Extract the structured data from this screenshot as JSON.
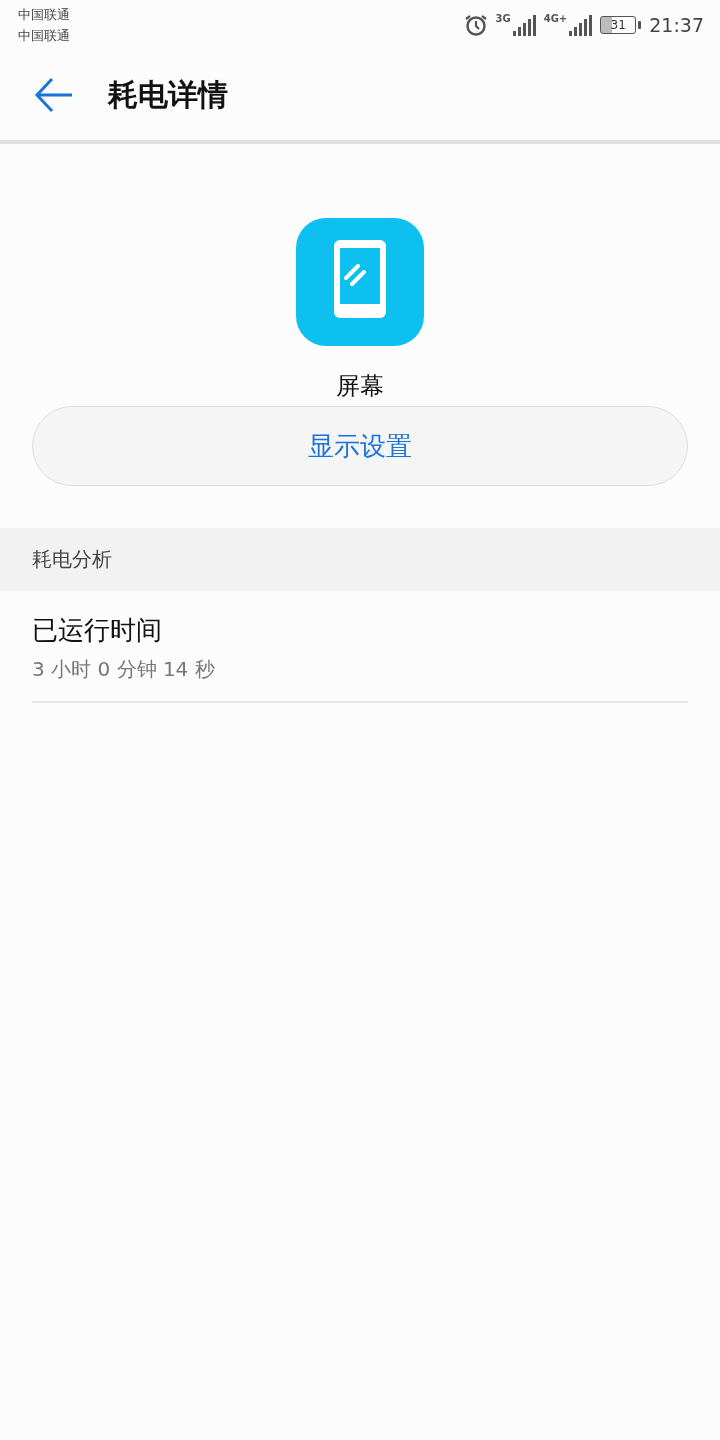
{
  "status_bar": {
    "carriers": [
      "中国联通",
      "中国联通"
    ],
    "sim1_network": "3G",
    "sim2_network": "4G+",
    "battery": "31",
    "time": "21:37"
  },
  "header": {
    "title": "耗电详情"
  },
  "app": {
    "name": "屏幕"
  },
  "settings_button": {
    "label": "显示设置"
  },
  "section": {
    "title": "耗电分析"
  },
  "items": [
    {
      "title": "已运行时间",
      "subtitle": "3 小时 0 分钟 14 秒"
    }
  ]
}
